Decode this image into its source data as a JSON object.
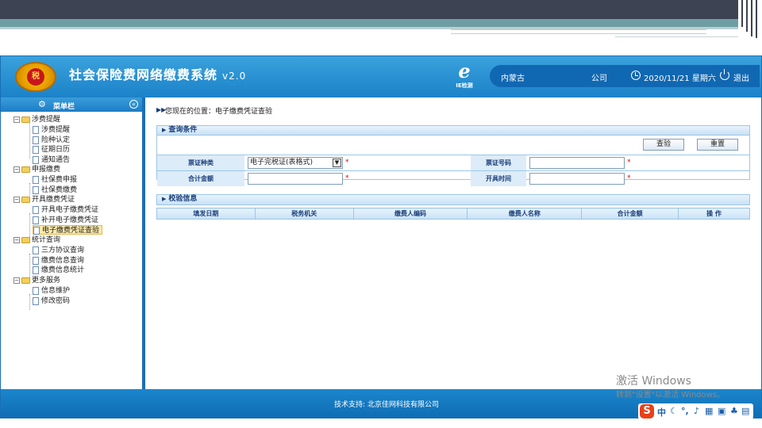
{
  "header": {
    "title": "社会保险费网络缴费系统",
    "version": "v2.0",
    "emblem_text": "税",
    "ie_label": "IE检测",
    "region": "内蒙古",
    "company": "公司",
    "datetime": "2020/11/21 星期六",
    "logout": "退出"
  },
  "sidebar": {
    "title": "菜单栏",
    "groups": [
      {
        "label": "涉费提醒",
        "items": [
          "涉费提醒",
          "险种认定",
          "征期日历",
          "通知通告"
        ]
      },
      {
        "label": "申报缴费",
        "items": [
          "社保费申报",
          "社保费缴费"
        ]
      },
      {
        "label": "开具缴费凭证",
        "items": [
          "开具电子缴费凭证",
          "补开电子缴费凭证",
          "电子缴费凭证查验"
        ]
      },
      {
        "label": "统计查询",
        "items": [
          "三方协议查询",
          "缴费信息查询",
          "缴费信息统计"
        ]
      },
      {
        "label": "更多服务",
        "items": [
          "信息维护",
          "修改密码"
        ]
      }
    ]
  },
  "content": {
    "breadcrumb": "您现在的位置：电子缴费凭证查验",
    "query": {
      "title": "查询条件",
      "search_button": "查验",
      "reset_button": "重置",
      "ticket_type_label": "票证种类",
      "ticket_type_value": "电子完税证(表格式)",
      "ticket_no_label": "票证号码",
      "total_label": "合计金额",
      "issue_time_label": "开具时间",
      "required": "*"
    },
    "result": {
      "title": "校验信息",
      "columns": [
        "填发日期",
        "税务机关",
        "缴费人编码",
        "缴费人名称",
        "合计金额",
        "操 作"
      ]
    }
  },
  "footer": {
    "text": "技术支持: 北京佳网科技有限公司"
  },
  "os": {
    "watermark_title": "激活 Windows",
    "watermark_sub": "转到\"设置\"以激活 Windows。",
    "ime_logo": "S",
    "ime_lang": "中"
  }
}
